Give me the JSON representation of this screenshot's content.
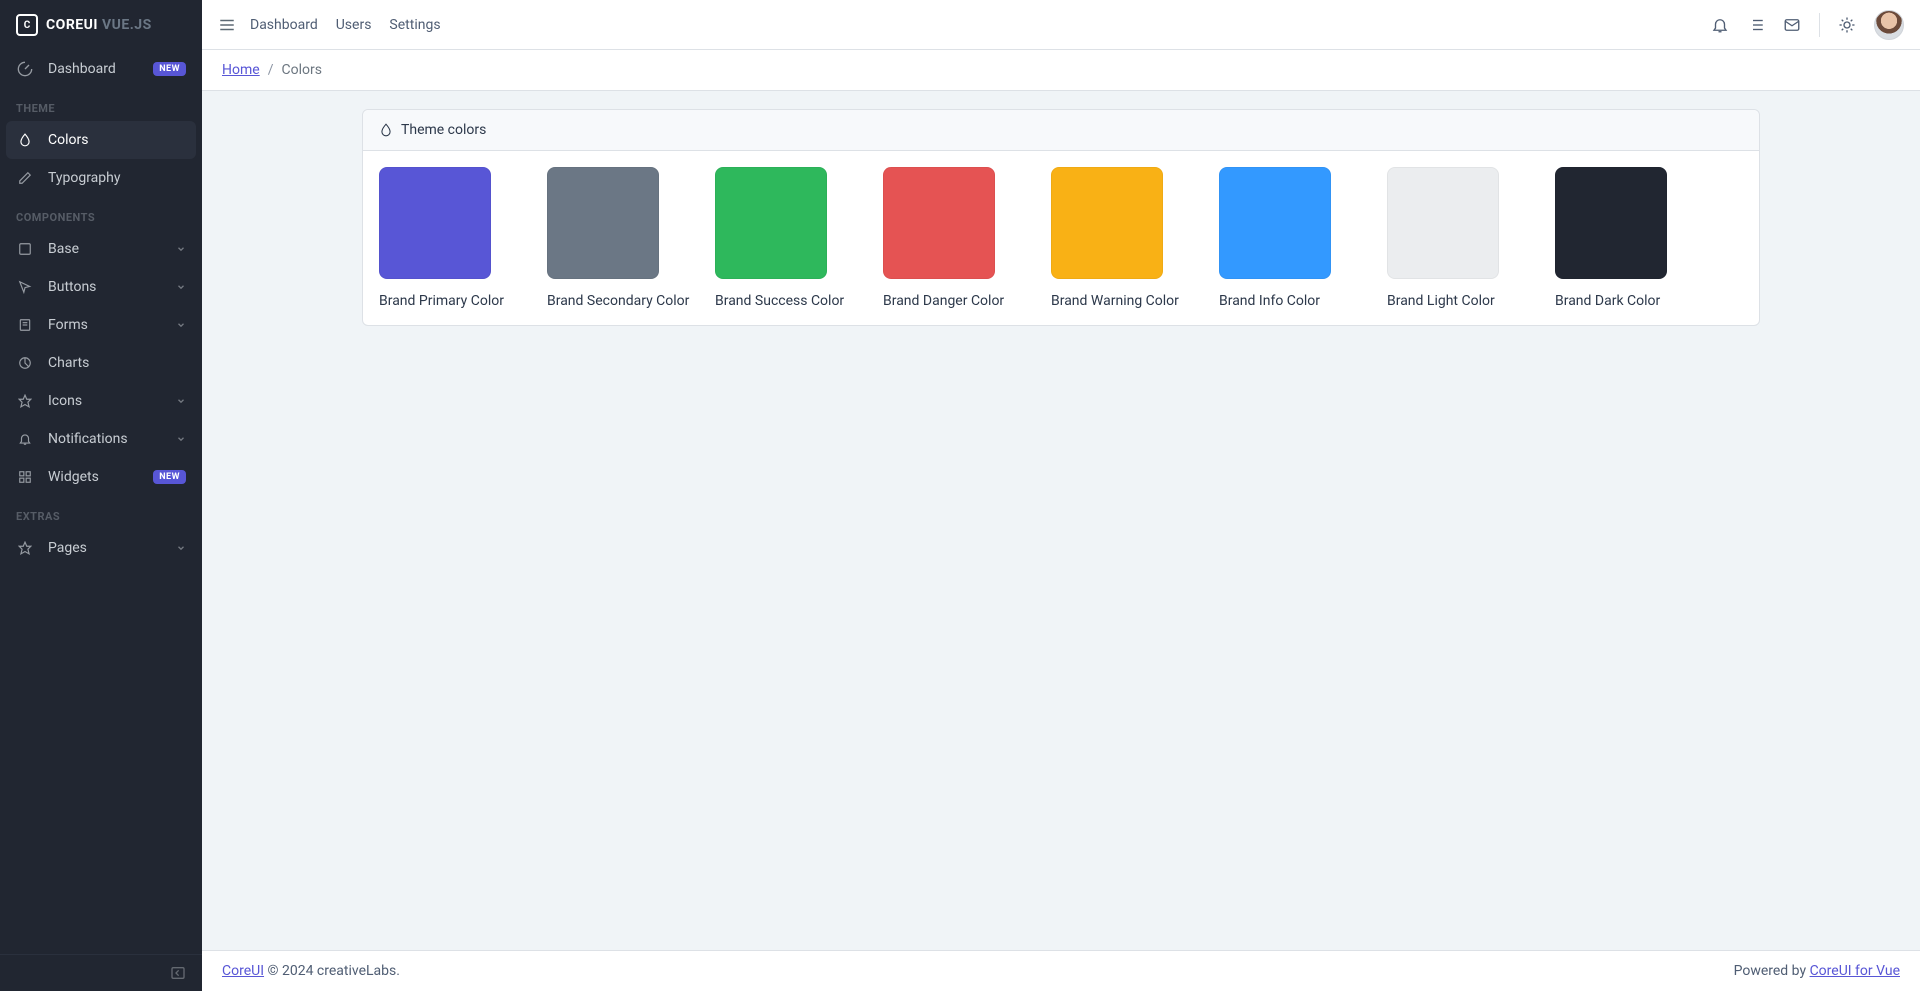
{
  "brand": {
    "core": "COREUI",
    "sub": "VUE.JS"
  },
  "sidebar": {
    "dashboard": {
      "label": "Dashboard",
      "badge": "NEW"
    },
    "title_theme": "THEME",
    "colors": {
      "label": "Colors"
    },
    "typography": {
      "label": "Typography"
    },
    "title_components": "COMPONENTS",
    "base": {
      "label": "Base"
    },
    "buttons": {
      "label": "Buttons"
    },
    "forms": {
      "label": "Forms"
    },
    "charts": {
      "label": "Charts"
    },
    "icons": {
      "label": "Icons"
    },
    "notifications": {
      "label": "Notifications"
    },
    "widgets": {
      "label": "Widgets",
      "badge": "NEW"
    },
    "title_extras": "EXTRAS",
    "pages": {
      "label": "Pages"
    }
  },
  "header": {
    "nav": {
      "dashboard": "Dashboard",
      "users": "Users",
      "settings": "Settings"
    }
  },
  "breadcrumb": {
    "home": "Home",
    "sep": "/",
    "current": "Colors"
  },
  "card1": {
    "title": "Theme colors",
    "swatches": [
      {
        "label": "Brand Primary Color",
        "hex": "#5856d6"
      },
      {
        "label": "Brand Secondary Color",
        "hex": "#6b7785"
      },
      {
        "label": "Brand Success Color",
        "hex": "#2eb85c"
      },
      {
        "label": "Brand Danger Color",
        "hex": "#e55353"
      },
      {
        "label": "Brand Warning Color",
        "hex": "#f9b115"
      },
      {
        "label": "Brand Info Color",
        "hex": "#3399ff"
      },
      {
        "label": "Brand Light Color",
        "hex": "#ebedef"
      },
      {
        "label": "Brand Dark Color",
        "hex": "#212631"
      }
    ]
  },
  "footer": {
    "link": "CoreUI",
    "copy": " © 2024 creativeLabs.",
    "powered": "Powered by ",
    "powered_link": "CoreUI for Vue"
  }
}
